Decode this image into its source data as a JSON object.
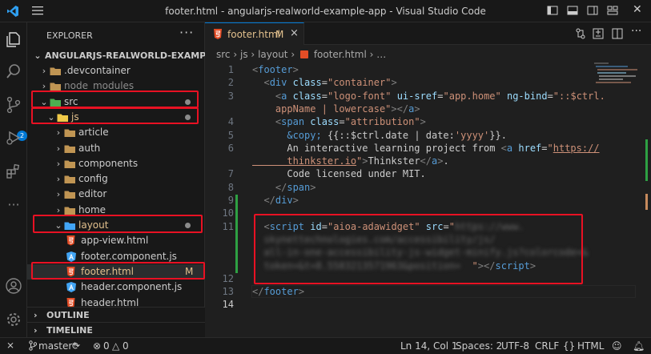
{
  "window": {
    "title": "footer.html - angularjs-realworld-example-app - Visual Studio Code"
  },
  "explorer": {
    "header": "EXPLORER",
    "more": "···",
    "project": "ANGULARJS-REALWORLD-EXAMPLE-APP",
    "tree": [
      {
        "label": ".devcontainer",
        "icon": "folder-icon",
        "depth": 1,
        "chevron": "›",
        "color": "#cccccc"
      },
      {
        "label": "node_modules",
        "icon": "folder-icon",
        "depth": 1,
        "chevron": "›",
        "color": "#8c8c8c"
      },
      {
        "label": "src",
        "icon": "folder-src-icon",
        "depth": 1,
        "chevron": "⌄",
        "color": "#cccccc",
        "dot": true
      },
      {
        "label": "js",
        "icon": "folder-js-icon",
        "depth": 2,
        "chevron": "⌄",
        "color": "#e2c08d",
        "dot": true
      },
      {
        "label": "article",
        "icon": "folder-icon",
        "depth": 3,
        "chevron": "›",
        "color": "#cccccc"
      },
      {
        "label": "auth",
        "icon": "folder-icon",
        "depth": 3,
        "chevron": "›",
        "color": "#cccccc"
      },
      {
        "label": "components",
        "icon": "folder-icon",
        "depth": 3,
        "chevron": "›",
        "color": "#cccccc"
      },
      {
        "label": "config",
        "icon": "folder-icon",
        "depth": 3,
        "chevron": "›",
        "color": "#cccccc"
      },
      {
        "label": "editor",
        "icon": "folder-icon",
        "depth": 3,
        "chevron": "›",
        "color": "#cccccc"
      },
      {
        "label": "home",
        "icon": "folder-icon",
        "depth": 3,
        "chevron": "›",
        "color": "#cccccc"
      },
      {
        "label": "layout",
        "icon": "folder-layout-icon",
        "depth": 3,
        "chevron": "⌄",
        "color": "#e2c08d",
        "dot": true
      },
      {
        "label": "app-view.html",
        "icon": "html-file-icon",
        "depth": 4,
        "chevron": "",
        "color": "#cccccc"
      },
      {
        "label": "footer.component.js",
        "icon": "angular-file-icon",
        "depth": 4,
        "chevron": "",
        "color": "#cccccc"
      },
      {
        "label": "footer.html",
        "icon": "html-file-icon",
        "depth": 4,
        "chevron": "",
        "color": "#e2c08d",
        "mark": "M",
        "selected": true
      },
      {
        "label": "header.component.js",
        "icon": "angular-file-icon",
        "depth": 4,
        "chevron": "",
        "color": "#cccccc"
      },
      {
        "label": "header.html",
        "icon": "html-file-icon",
        "depth": 4,
        "chevron": "",
        "color": "#cccccc"
      }
    ],
    "outline": "OUTLINE",
    "timeline": "TIMELINE"
  },
  "tab": {
    "label": "footer.html",
    "modified": "M",
    "close": "×"
  },
  "breadcrumbs": {
    "parts": [
      "src",
      "js",
      "layout",
      "footer.html",
      "…"
    ],
    "sep": "›"
  },
  "editor": {
    "lines": [
      {
        "num": "1",
        "spans": [
          [
            "t",
            "<"
          ],
          [
            "n",
            "footer"
          ],
          [
            "t",
            ">"
          ]
        ]
      },
      {
        "num": "2",
        "spans": [
          [
            "tx",
            "  "
          ],
          [
            "t",
            "<"
          ],
          [
            "n",
            "div"
          ],
          [
            "tx",
            " "
          ],
          [
            "a",
            "class"
          ],
          [
            "tx",
            "="
          ],
          [
            "s",
            "\"container\""
          ],
          [
            "t",
            ">"
          ]
        ]
      },
      {
        "num": "3",
        "spans": [
          [
            "tx",
            "    "
          ],
          [
            "t",
            "<"
          ],
          [
            "n",
            "a"
          ],
          [
            "tx",
            " "
          ],
          [
            "a",
            "class"
          ],
          [
            "tx",
            "="
          ],
          [
            "s",
            "\"logo-font\""
          ],
          [
            "tx",
            " "
          ],
          [
            "a",
            "ui-sref"
          ],
          [
            "tx",
            "="
          ],
          [
            "s",
            "\"app.home\""
          ],
          [
            "tx",
            " "
          ],
          [
            "a",
            "ng-bind"
          ],
          [
            "tx",
            "="
          ],
          [
            "s",
            "\"::$ctrl."
          ]
        ]
      },
      {
        "num": "",
        "spans": [
          [
            "s",
            "    appName | lowercase\""
          ],
          [
            "t",
            ">"
          ],
          [
            "t",
            "</"
          ],
          [
            "n",
            "a"
          ],
          [
            "t",
            ">"
          ]
        ]
      },
      {
        "num": "4",
        "spans": [
          [
            "tx",
            "    "
          ],
          [
            "t",
            "<"
          ],
          [
            "n",
            "span"
          ],
          [
            "tx",
            " "
          ],
          [
            "a",
            "class"
          ],
          [
            "tx",
            "="
          ],
          [
            "s",
            "\"attribution\""
          ],
          [
            "t",
            ">"
          ]
        ]
      },
      {
        "num": "5",
        "spans": [
          [
            "tx",
            "      "
          ],
          [
            "n",
            "&copy;"
          ],
          [
            "tx",
            " {{::$ctrl.date | date:"
          ],
          [
            "s",
            "'yyyy'"
          ],
          [
            "tx",
            "}}."
          ]
        ]
      },
      {
        "num": "6",
        "spans": [
          [
            "tx",
            "      An interactive learning project from "
          ],
          [
            "t",
            "<"
          ],
          [
            "n",
            "a"
          ],
          [
            "tx",
            " "
          ],
          [
            "a",
            "href"
          ],
          [
            "tx",
            "="
          ],
          [
            "s",
            "\""
          ],
          [
            "u",
            "https://"
          ]
        ]
      },
      {
        "num": "",
        "spans": [
          [
            "u",
            "      thinkster.io"
          ],
          [
            "s",
            "\""
          ],
          [
            "t",
            ">"
          ],
          [
            "tx",
            "Thinkster"
          ],
          [
            "t",
            "</"
          ],
          [
            "n",
            "a"
          ],
          [
            "t",
            ">"
          ],
          [
            "tx",
            "."
          ]
        ]
      },
      {
        "num": "7",
        "spans": [
          [
            "tx",
            "      Code licensed under MIT."
          ]
        ]
      },
      {
        "num": "8",
        "spans": [
          [
            "tx",
            "    "
          ],
          [
            "t",
            "</"
          ],
          [
            "n",
            "span"
          ],
          [
            "t",
            ">"
          ]
        ]
      },
      {
        "num": "9",
        "spans": [
          [
            "tx",
            "  "
          ],
          [
            "t",
            "</"
          ],
          [
            "n",
            "div"
          ],
          [
            "t",
            ">"
          ]
        ]
      },
      {
        "num": "10",
        "spans": []
      },
      {
        "num": "11",
        "spans": [
          [
            "tx",
            "  "
          ],
          [
            "t",
            "<"
          ],
          [
            "n",
            "script"
          ],
          [
            "tx",
            " "
          ],
          [
            "a",
            "id"
          ],
          [
            "tx",
            "="
          ],
          [
            "s",
            "\"aioa-adawidget\""
          ],
          [
            "tx",
            " "
          ],
          [
            "a",
            "src"
          ],
          [
            "tx",
            "="
          ],
          [
            "s",
            "\""
          ],
          [
            "blur",
            "https://www."
          ]
        ]
      },
      {
        "num": "",
        "spans": [
          [
            "blur",
            "  skynettechnologies.com/accessibility/js/"
          ]
        ]
      },
      {
        "num": "",
        "spans": [
          [
            "blur",
            "  all-in-one-accessibility-js-widget-minify.js?colorcode=&"
          ]
        ]
      },
      {
        "num": "",
        "spans": [
          [
            "blur",
            "  token=&t=8.5583213571963&position=  "
          ],
          [
            "s",
            "\""
          ],
          [
            "t",
            "></"
          ],
          [
            "n",
            "script"
          ],
          [
            "t",
            ">"
          ]
        ]
      },
      {
        "num": "12",
        "spans": []
      },
      {
        "num": "13",
        "spans": [
          [
            "t",
            "</"
          ],
          [
            "n",
            "footer"
          ],
          [
            "t",
            ">"
          ]
        ]
      },
      {
        "num": "14",
        "spans": []
      }
    ]
  },
  "status": {
    "branch": "master*",
    "problems_errors": "0",
    "problems_warnings": "0",
    "position": "Ln 14, Col 1",
    "spaces": "Spaces: 2",
    "encoding": "UTF-8",
    "eol": "CRLF",
    "language": "HTML"
  },
  "scm": {
    "badge": "2"
  },
  "colors": {
    "accent": "#0078d4",
    "highlight": "#e81123",
    "modified": "#e2c08d",
    "added": "#2ea043"
  }
}
